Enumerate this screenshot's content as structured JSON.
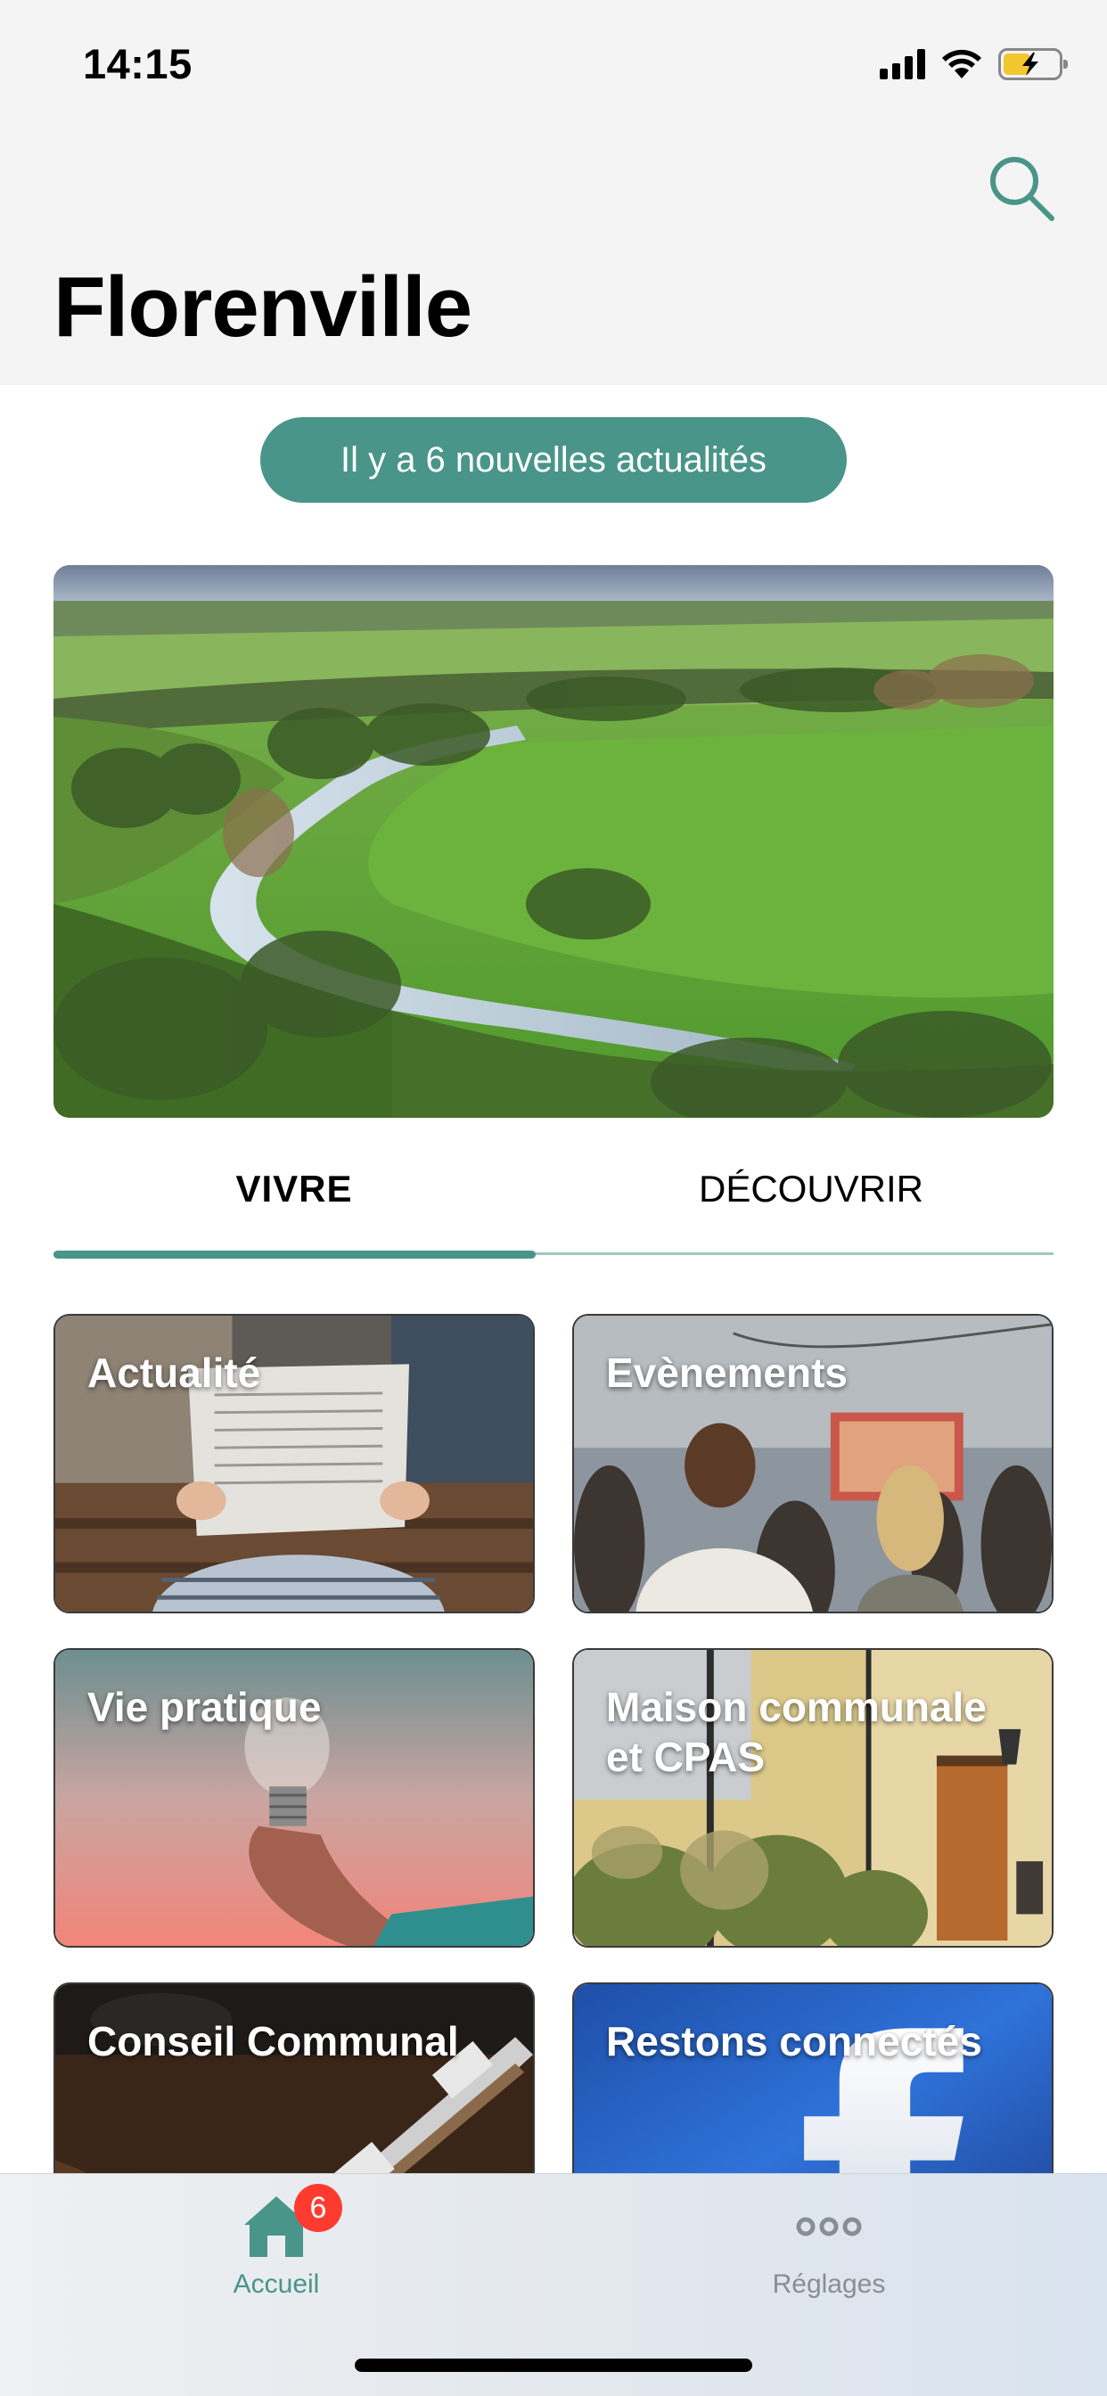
{
  "status_bar": {
    "time": "14:15"
  },
  "header": {
    "title": "Florenville"
  },
  "news_banner": {
    "label": "Il y a 6 nouvelles actualités"
  },
  "tabs": [
    {
      "label": "VIVRE",
      "active": true
    },
    {
      "label": "DÉCOUVRIR",
      "active": false
    }
  ],
  "tiles": [
    {
      "label": "Actualité"
    },
    {
      "label": "Evènements"
    },
    {
      "label": "Vie pratique"
    },
    {
      "label": "Maison communale et CPAS"
    },
    {
      "label": "Conseil Communal"
    },
    {
      "label": "Restons connectés"
    }
  ],
  "tab_bar": {
    "home_label": "Accueil",
    "home_badge": "6",
    "settings_label": "Réglages"
  },
  "colors": {
    "accent": "#4a9589",
    "badge": "#ff3b30",
    "header_bg": "#f4f4f4"
  },
  "icons": [
    "search-icon",
    "home-icon",
    "more-icon",
    "signal-icon",
    "wifi-icon",
    "battery-icon"
  ]
}
